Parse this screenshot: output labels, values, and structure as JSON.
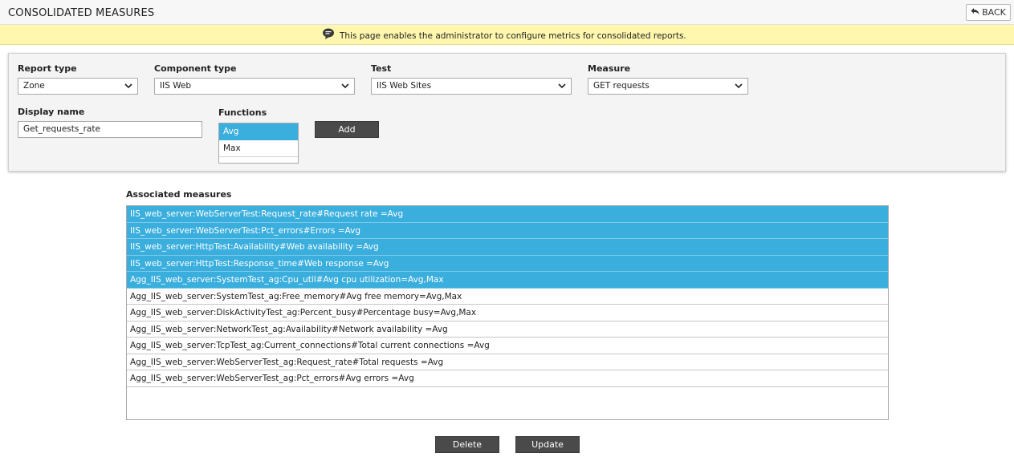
{
  "header": {
    "title": "CONSOLIDATED MEASURES",
    "back_label": "BACK"
  },
  "info": {
    "message": "This page enables the administrator to configure metrics for consolidated reports."
  },
  "form": {
    "report_type": {
      "label": "Report type",
      "value": "Zone"
    },
    "component_type": {
      "label": "Component type",
      "value": "IIS Web"
    },
    "test": {
      "label": "Test",
      "value": "IIS Web Sites"
    },
    "measure": {
      "label": "Measure",
      "value": "GET requests"
    },
    "display_name": {
      "label": "Display name",
      "value": "Get_requests_rate"
    },
    "functions": {
      "label": "Functions",
      "items": [
        {
          "label": "Avg",
          "selected": true
        },
        {
          "label": "Max",
          "selected": false
        }
      ]
    },
    "add_label": "Add"
  },
  "associated": {
    "label": "Associated measures",
    "items": [
      {
        "text": "IIS_web_server:WebServerTest:Request_rate#Request rate =Avg",
        "selected": true
      },
      {
        "text": "IIS_web_server:WebServerTest:Pct_errors#Errors =Avg",
        "selected": true
      },
      {
        "text": "IIS_web_server:HttpTest:Availability#Web availability =Avg",
        "selected": true
      },
      {
        "text": "IIS_web_server:HttpTest:Response_time#Web response =Avg",
        "selected": true
      },
      {
        "text": "Agg_IIS_web_server:SystemTest_ag:Cpu_util#Avg cpu utilization=Avg,Max",
        "selected": true
      },
      {
        "text": "Agg_IIS_web_server:SystemTest_ag:Free_memory#Avg free memory=Avg,Max",
        "selected": false
      },
      {
        "text": "Agg_IIS_web_server:DiskActivityTest_ag:Percent_busy#Percentage busy=Avg,Max",
        "selected": false
      },
      {
        "text": "Agg_IIS_web_server:NetworkTest_ag:Availability#Network availability =Avg",
        "selected": false
      },
      {
        "text": "Agg_IIS_web_server:TcpTest_ag:Current_connections#Total current connections =Avg",
        "selected": false
      },
      {
        "text": "Agg_IIS_web_server:WebServerTest_ag:Request_rate#Total requests =Avg",
        "selected": false
      },
      {
        "text": "Agg_IIS_web_server:WebServerTest_ag:Pct_errors#Avg errors =Avg",
        "selected": false
      }
    ]
  },
  "actions": {
    "delete_label": "Delete",
    "update_label": "Update"
  },
  "colors": {
    "selection": "#3aaedd",
    "info_bar": "#fff7ad",
    "dark_button": "#4a4a4a"
  }
}
